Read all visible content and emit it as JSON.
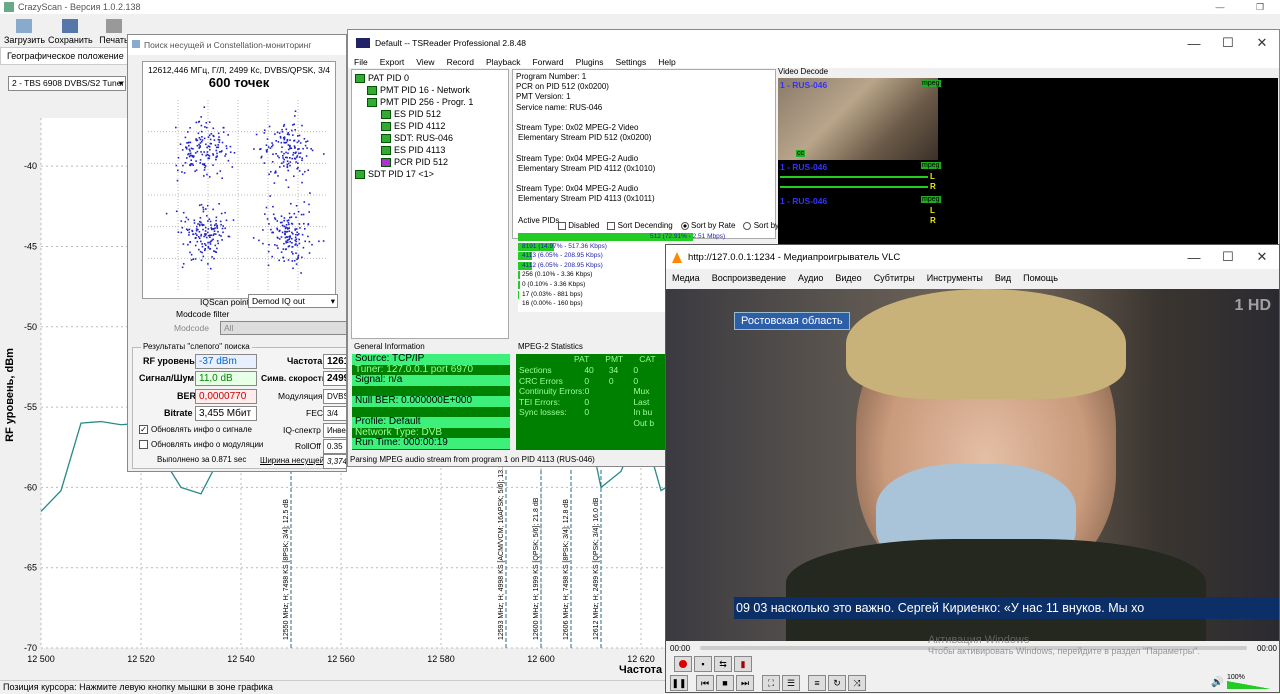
{
  "crazyscan": {
    "title": "CrazyScan - Версия 1.0.2.138",
    "toolbar": [
      "Загрузить",
      "Сохранить",
      "Печать"
    ],
    "tabs": [
      "Географическое положение",
      "И"
    ],
    "tuner_select": "2 - TBS 6908 DVBS/S2 Tuner 0",
    "ylabel": "RF уровень, dBm",
    "xlabel": "Частота",
    "status": "Позиция курсора: Нажмите левую кнопку мышки в зоне графика",
    "markers": [
      "12550 MHz; H; 7498 KS [8PSK; 3/4]; 12.5 dB",
      "12593 MHz; H; 4998 KS [ACM/VCM; 16APSK; 5/6]; 13.1 dB",
      "12600 MHz; H; 1999 KS [QPSK; 5/6]; 21.8 dB",
      "12606 MHz; H; 7498 KS [8PSK; 3/4]; 12.8 dB",
      "12612 MHz; H; 2499 KS [QPSK; 3/4]; 16.0 dB"
    ]
  },
  "chart_data": {
    "type": "line",
    "xlabel": "Частота",
    "ylabel": "RF уровень, dBm",
    "xlim": [
      12500,
      12625
    ],
    "ylim": [
      -70,
      -37
    ],
    "x_ticks": [
      "12 500",
      "12 520",
      "12 540",
      "12 560",
      "12 580",
      "12 600",
      "12 620"
    ],
    "y_ticks": [
      "-40",
      "-45",
      "-50",
      "-55",
      "-60",
      "-65",
      "-70"
    ],
    "x": [
      12500,
      12504,
      12508,
      12512,
      12516,
      12520,
      12524,
      12528,
      12532,
      12536,
      12540,
      12610,
      12612,
      12616,
      12620,
      12622,
      12624,
      12625
    ],
    "y": [
      -61.5,
      -60.2,
      -56,
      -55.9,
      -56.1,
      -56,
      -58,
      -60,
      -60.4,
      -58,
      -56,
      -57,
      -60,
      -59,
      -56,
      -58,
      -60.2,
      -60
    ],
    "grid": true
  },
  "constellation": {
    "title": "Поиск несущей и Constellation-мониторинг",
    "info": "12612,446 МГц, Г/Л, 2499 Кс, DVBS/QPSK, 3/4",
    "points": "600 точек",
    "iqscan_label": "IQScan point",
    "iqscan_value": "Demod IQ out",
    "modcode_filter": "Modcode filter",
    "modcode_label": "Modcode",
    "modcode_value": "All",
    "group_title": "Результаты \"слепого\" поиска",
    "rf_label": "RF уровень",
    "rf_value": "-37 dBm",
    "snr_label": "Сигнал/Шум",
    "snr_value": "11,0 dB",
    "ber_label": "BER",
    "ber_value": "0,0000770",
    "bitrate_label": "Bitrate",
    "bitrate_value": "3,455 Мбит",
    "freq_label": "Частота",
    "freq_value": "12612",
    "sr_label": "Симв. скорость",
    "sr_value": "2499 К",
    "mod_label": "Модуляция",
    "mod_value": "DVBS/QP",
    "fec_label": "FEC",
    "fec_value": "3/4",
    "iq_label": "IQ-спектр",
    "iq_value": "Инверс",
    "rolloff_label": "RollOff",
    "rolloff_value": "0.35",
    "chk1": "Обновлять инфо о сигнале",
    "chk2": "Обновлять инфо о модуляции",
    "done": "Выполнено за 0.871 sec",
    "bw_label": "Ширина несущей",
    "bw_value": "3,374 М"
  },
  "tsreader": {
    "title": "Default -- TSReader Professional 2.8.48",
    "menu": [
      "File",
      "Export",
      "View",
      "Record",
      "Playback",
      "Forward",
      "Plugins",
      "Settings",
      "Help"
    ],
    "tree": [
      "PAT PID 0",
      "PMT PID 16 - Network",
      "PMT PID 256 - Progr. 1",
      "ES PID 512",
      "ES PID 4112",
      "SDT: RUS-046",
      "ES PID 4113",
      "PCR PID 512",
      "SDT PID 17 <1>"
    ],
    "details": [
      "Program Number: 1",
      "PCR on PID 512 (0x0200)",
      "PMT Version: 1",
      "Service name: RUS-046",
      "",
      "Stream Type: 0x02 MPEG-2 Video",
      "Elementary Stream PID 512 (0x0200)",
      "",
      "Stream Type: 0x04 MPEG-2 Audio",
      "Elementary Stream PID 4112 (0x1010)",
      "",
      "Stream Type: 0x04 MPEG-2 Audio",
      "Elementary Stream PID 4113 (0x1011)"
    ],
    "active_pids": "Active PIDs",
    "opt_disabled": "Disabled",
    "opt_sortdesc": "Sort Decending",
    "opt_rate": "Sort by Rate",
    "opt_pid": "Sort by PID",
    "pids": [
      "512 (72.91% - 2.51 Mbps)",
      "8191 (14.97% - 517.36 Kbps)",
      "4113 (6.05% - 208.95 Kbps)",
      "4112 (6.05% - 208.95 Kbps)",
      "256 (0.10% - 3.36 Kbps)",
      "0 (0.10% - 3.36 Kbps)",
      "17 (0.03% - 881 bps)",
      "16 (0.00% - 160 bps)"
    ],
    "pid_fracs": [
      0.73,
      0.15,
      0.06,
      0.06,
      0.01,
      0.01,
      0.003,
      0.0
    ],
    "general_title": "General Information",
    "general": [
      "Source: TCP/IP",
      "Tuner: 127.0.0.1 port 6970",
      "Signal: n/a",
      "",
      "Null BER: 0.000000E+000",
      "",
      "Profile: Default",
      "Network Type: DVB",
      "Run Time: 000:00:19"
    ],
    "mpeg_title": "MPEG-2 Statistics",
    "mpeg_head": [
      "PAT",
      "PMT",
      "CAT"
    ],
    "mpeg_rows": [
      [
        "Sections",
        "40",
        "34",
        "0"
      ],
      [
        "CRC Errors",
        "0",
        "0",
        "0"
      ],
      [
        "Continuity Errors:",
        "0",
        "",
        "Mux"
      ],
      [
        "TEI Errors:",
        "0",
        "",
        "Last"
      ],
      [
        "Sync losses:",
        "0",
        "",
        "In bu"
      ],
      [
        "",
        "",
        "",
        "Out b"
      ]
    ],
    "status": "Parsing MPEG audio stream from program 1 on PID 4113 (RUS-046)",
    "video_title": "Video Decode",
    "vd_label1": "1 - RUS-046",
    "vd_label2": "1 - RUS-046",
    "vd_label3": "1 - RUS-046",
    "mpeg_tag": "mpeg",
    "l": "L",
    "r": "R",
    "cc": "cc"
  },
  "vlc": {
    "title": "http://127.0.0.1:1234 - Медиапроигрыватель VLC",
    "menu": [
      "Медиа",
      "Воспроизведение",
      "Аудио",
      "Видео",
      "Субтитры",
      "Инструменты",
      "Вид",
      "Помощь"
    ],
    "region": "Ростовская область",
    "logo": "1 HD",
    "ticker": "09 03  насколько это важно.   Сергей Кириенко: «У нас 11 внуков.   Мы хо",
    "time_start": "00:00",
    "time_end": "00:00",
    "volume": "100%"
  },
  "windows_activate": [
    "Активация Windows",
    "Чтобы активировать Windows, перейдите в раздел \"Параметры\"."
  ]
}
